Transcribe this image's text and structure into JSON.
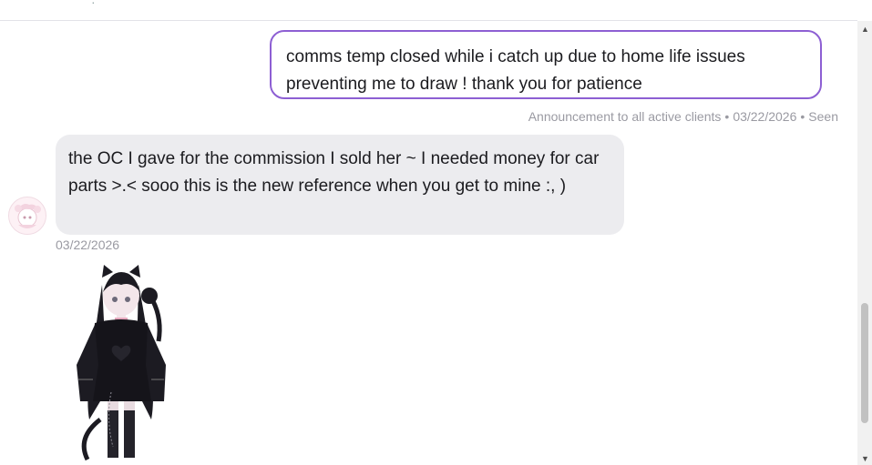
{
  "messages": {
    "outgoing": {
      "text": "comms temp closed while i catch up due to home life issues preventing me to draw ! thank you for patience",
      "meta_label": "Announcement to all active clients",
      "date": "03/22/2026",
      "status": "Seen"
    },
    "incoming": {
      "text": "the OC I gave for the commission I sold her ~ I needed money for car parts >.< sooo this is the new reference when you get to mine :, )",
      "date": "03/22/2026"
    }
  },
  "icons": {
    "avatar": "avatar-image",
    "attachment": "character-reference-image",
    "scroll_up": "chevron-up-icon",
    "scroll_down": "chevron-down-icon"
  },
  "colors": {
    "outgoing_border": "#8d5fd3",
    "incoming_bg": "#ececef",
    "meta_text": "#9a9aa2"
  }
}
